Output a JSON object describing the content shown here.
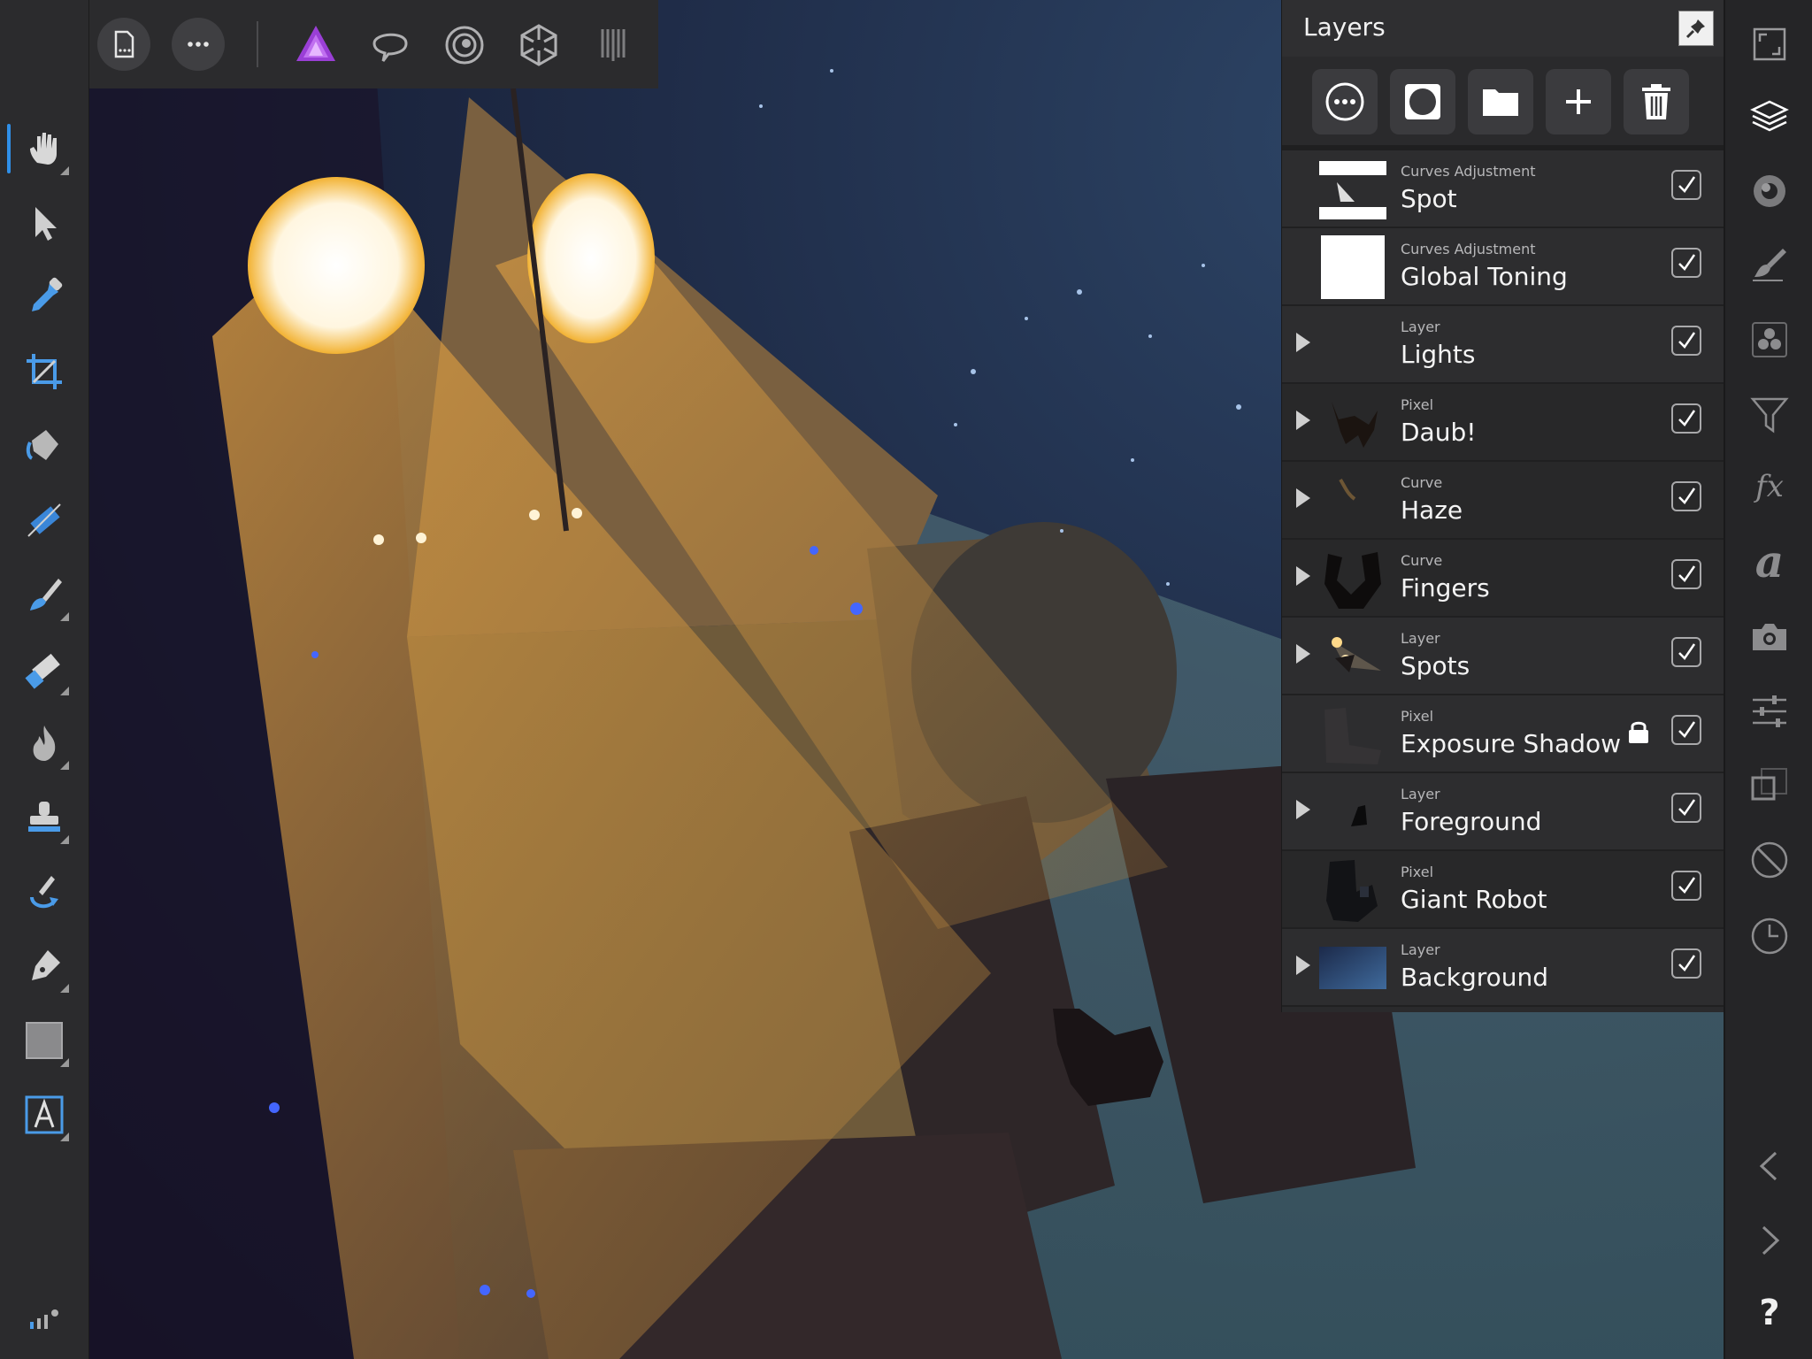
{
  "top_toolbar": {
    "buttons": [
      {
        "id": "back",
        "icon": "arrow-left-icon"
      },
      {
        "id": "document",
        "icon": "document-icon"
      },
      {
        "id": "more",
        "icon": "ellipsis-icon"
      }
    ],
    "personas": [
      {
        "id": "photo",
        "icon": "photo-persona-icon",
        "color": "#b24fe0"
      },
      {
        "id": "liquify",
        "icon": "liquify-persona-icon"
      },
      {
        "id": "develop",
        "icon": "develop-persona-icon"
      },
      {
        "id": "tone-mapping",
        "icon": "tone-mapping-persona-icon"
      },
      {
        "id": "export",
        "icon": "export-persona-icon"
      }
    ]
  },
  "left_tools": [
    {
      "id": "view",
      "icon": "hand-icon",
      "active": true
    },
    {
      "id": "move",
      "icon": "move-arrow-icon"
    },
    {
      "id": "color-picker",
      "icon": "eyedropper-icon"
    },
    {
      "id": "crop",
      "icon": "crop-icon"
    },
    {
      "id": "flood-fill",
      "icon": "paint-bucket-icon"
    },
    {
      "id": "gradient",
      "icon": "gradient-icon"
    },
    {
      "id": "paint-brush",
      "icon": "paint-brush-icon"
    },
    {
      "id": "erase",
      "icon": "eraser-icon"
    },
    {
      "id": "dodge-burn",
      "icon": "flame-icon"
    },
    {
      "id": "clone",
      "icon": "stamp-icon"
    },
    {
      "id": "undo-brush",
      "icon": "undo-brush-icon"
    },
    {
      "id": "pen",
      "icon": "pen-icon"
    },
    {
      "id": "shape",
      "icon": "rectangle-icon"
    },
    {
      "id": "text",
      "icon": "text-frame-icon"
    },
    {
      "id": "quick-menu",
      "icon": "quick-menu-icon"
    }
  ],
  "layers_panel": {
    "title": "Layers",
    "actions": [
      {
        "id": "options",
        "icon": "ellipsis-circle-icon"
      },
      {
        "id": "mask",
        "icon": "mask-icon"
      },
      {
        "id": "group",
        "icon": "folder-icon"
      },
      {
        "id": "add",
        "icon": "plus-icon"
      },
      {
        "id": "delete",
        "icon": "trash-icon"
      }
    ],
    "layers": [
      {
        "type": "Curves Adjustment",
        "name": "Spot",
        "expandable": false,
        "visible": true,
        "locked": false,
        "tag": ""
      },
      {
        "type": "Curves Adjustment",
        "name": "Global Toning",
        "expandable": false,
        "visible": true,
        "locked": false,
        "tag": ""
      },
      {
        "type": "Layer",
        "name": "Lights",
        "expandable": true,
        "visible": true,
        "locked": false,
        "tag": "#c8502a"
      },
      {
        "type": "Pixel",
        "name": "Daub!",
        "expandable": true,
        "visible": true,
        "locked": false,
        "tag": ""
      },
      {
        "type": "Curve",
        "name": "Haze",
        "expandable": true,
        "visible": true,
        "locked": false,
        "tag": ""
      },
      {
        "type": "Curve",
        "name": "Fingers",
        "expandable": true,
        "visible": true,
        "locked": false,
        "tag": ""
      },
      {
        "type": "Layer",
        "name": "Spots",
        "expandable": true,
        "visible": true,
        "locked": false,
        "tag": "#e2a92a"
      },
      {
        "type": "Pixel",
        "name": "Exposure Shadow",
        "expandable": false,
        "visible": true,
        "locked": true,
        "tag": ""
      },
      {
        "type": "Layer",
        "name": "Foreground",
        "expandable": true,
        "visible": true,
        "locked": false,
        "tag": "#2f6fd8"
      },
      {
        "type": "Pixel",
        "name": "Giant Robot",
        "expandable": false,
        "visible": true,
        "locked": false,
        "tag": ""
      },
      {
        "type": "Layer",
        "name": "Background",
        "expandable": true,
        "visible": true,
        "locked": false,
        "tag": "#2f6fd8"
      }
    ]
  },
  "studio_bar": [
    {
      "id": "fullscreen",
      "icon": "fullscreen-icon"
    },
    {
      "id": "layers",
      "icon": "layers-stack-icon",
      "active": true
    },
    {
      "id": "color",
      "icon": "color-wheel-icon"
    },
    {
      "id": "brushes",
      "icon": "brush-icon"
    },
    {
      "id": "channels",
      "icon": "channels-icon"
    },
    {
      "id": "filters",
      "icon": "filter-funnel-icon"
    },
    {
      "id": "fx",
      "icon": "fx-icon",
      "text": "fx"
    },
    {
      "id": "text-styles",
      "icon": "text-styles-icon",
      "text": "a"
    },
    {
      "id": "stock",
      "icon": "camera-icon"
    },
    {
      "id": "adjustments",
      "icon": "sliders-icon"
    },
    {
      "id": "transform",
      "icon": "transform-icon"
    },
    {
      "id": "navigator",
      "icon": "navigator-icon"
    },
    {
      "id": "history",
      "icon": "clock-icon"
    },
    {
      "id": "collapse-left",
      "icon": "chevron-left-icon"
    },
    {
      "id": "collapse-right",
      "icon": "chevron-right-icon"
    },
    {
      "id": "help",
      "icon": "help-icon",
      "text": "?"
    }
  ]
}
